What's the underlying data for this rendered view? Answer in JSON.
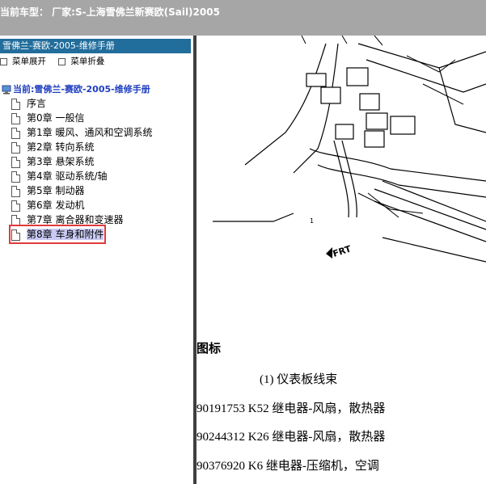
{
  "header": {
    "title": "当前车型：  厂家:S-上海雪佛兰新赛欧(Sail)2005"
  },
  "left_panel": {
    "title": "雪佛兰-赛欧-2005-维修手册",
    "actions": [
      "菜单展开",
      "菜单折叠"
    ],
    "tree_root": "当前:雪佛兰-赛欧-2005-维修手册",
    "items": [
      {
        "label": "序言"
      },
      {
        "label": "第0章 一般信"
      },
      {
        "label": "第1章 暖风、通风和空调系统"
      },
      {
        "label": "第2章 转向系统"
      },
      {
        "label": "第3章 悬架系统"
      },
      {
        "label": "第4章 驱动系统/轴"
      },
      {
        "label": "第5章 制动器"
      },
      {
        "label": "第6章 发动机"
      },
      {
        "label": "第7章 离合器和变速器"
      },
      {
        "label": "第8章 车身和附件",
        "selected": true
      }
    ]
  },
  "content": {
    "diagram_labels": {
      "callout": "1",
      "direction": "FRT"
    },
    "figure_title": "图标",
    "legend": [
      "(1) 仪表板线束",
      "90191753 K52 继电器-风扇，散热器",
      "90244312 K26 继电器-风扇，散热器",
      "90376920 K6 继电器-压缩机，空调"
    ]
  },
  "colors": {
    "header_bg": "#a6a6a6",
    "panel_title_bg": "#216d9c",
    "splitter": "#3f3f3f",
    "selection_bg": "#c9c9f3",
    "highlight_border": "#e23a3a"
  }
}
